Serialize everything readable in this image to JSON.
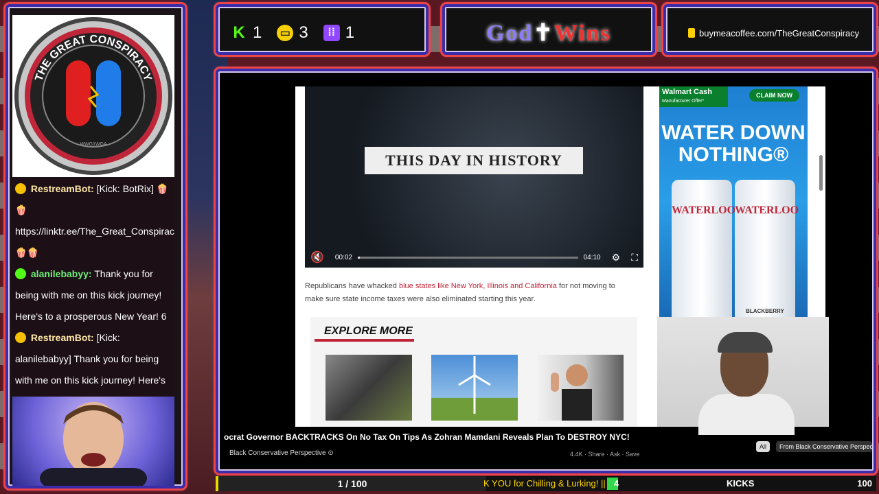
{
  "top_stats": [
    {
      "icon": "kick-icon",
      "value": "1",
      "color": "#53fc18"
    },
    {
      "icon": "rumble-icon",
      "value": "3",
      "color": "#f6d000"
    },
    {
      "icon": "twitch-icon",
      "value": "1",
      "color": "#9146ff"
    }
  ],
  "banner": {
    "god": "God",
    "wins": "Wins"
  },
  "coffee_link": "buymeacoffee.com/TheGreatConspiracy",
  "logo": {
    "text": "THE GREAT CONSPIRACY",
    "sub": "WWG1WGA"
  },
  "chat": [
    {
      "user": "RestreamBot:",
      "text": "[Kick: BotRix] 🍿🍿 https://linktr.ee/The_Great_Conspiracy 🍿🍿",
      "user_color": "#ffe9a8"
    },
    {
      "user": "alanilebabyy:",
      "text": "Thank you for being with me on this kick journey! Here's to a prosperous New Year! 6",
      "user_color": "#6ff07a"
    },
    {
      "user": "RestreamBot:",
      "text": "[Kick: alanilebabyy] Thank you for being with me on this kick journey! Here's to a prosperous New Year! [emote:4913185:alanilebabyyNYE2026]",
      "user_color": "#ffe9a8"
    }
  ],
  "video": {
    "overlay_title": "THIS DAY IN HISTORY",
    "current_time": "00:02",
    "duration": "04:10",
    "progress": 0.01
  },
  "article": {
    "before": "Republicans have whacked ",
    "link": "blue states like New York, Illinois and California",
    "after": " for not moving to make sure state income taxes were also eliminated starting this year."
  },
  "explore": {
    "heading": "EXPLORE MORE"
  },
  "ad": {
    "cash": "Walmart Cash",
    "cash_sub": "Manufacturer Offer*",
    "claim": "CLAIM NOW",
    "headline": "WATER DOWN NOTHING®",
    "can1": "WATERLOO",
    "can2": "WATERLOO",
    "flavor": "BLACKBERRY"
  },
  "yt": {
    "title": "ocrat Governor BACKTRACKS On No Tax On Tips As Zohran Mamdani Reveals Plan To DESTROY NYC!",
    "channel": "Black Conservative Perspective ⊙",
    "actions": "4.4K   ·   Share   ·   Ask   ·   Save",
    "chip_all": "All",
    "chip_from": "From Black Conservative Perspective"
  },
  "footer": {
    "goal": "1 / 100",
    "ticker": "K YOU for Chilling & Lurking!  ||  Ma",
    "kicks_current": "4",
    "kicks_label": "KICKS",
    "kicks_max": "100",
    "kicks_progress": 0.04
  }
}
